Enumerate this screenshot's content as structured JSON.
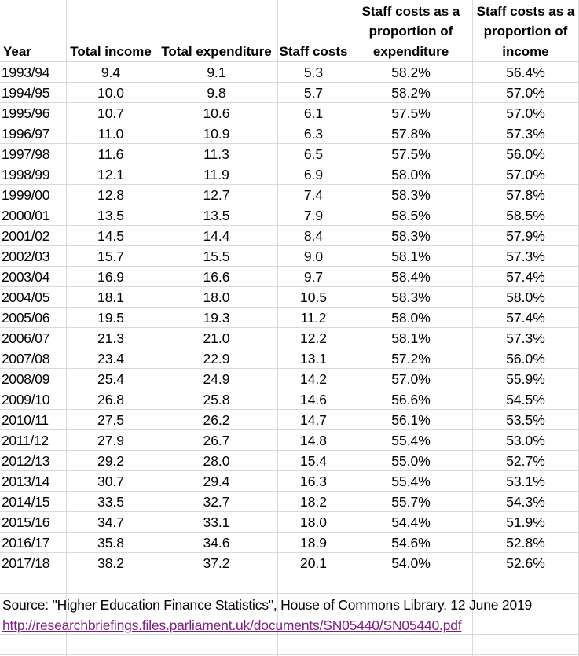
{
  "headers": {
    "year": "Year",
    "total_income": "Total income",
    "total_expenditure": "Total expenditure",
    "staff_costs": "Staff costs",
    "staff_pct_expenditure": "Staff costs as a proportion of expenditure",
    "staff_pct_income": "Staff costs as a proportion of income"
  },
  "rows": [
    [
      "1993/94",
      "9.4",
      "9.1",
      "5.3",
      "58.2%",
      "56.4%"
    ],
    [
      "1994/95",
      "10.0",
      "9.8",
      "5.7",
      "58.2%",
      "57.0%"
    ],
    [
      "1995/96",
      "10.7",
      "10.6",
      "6.1",
      "57.5%",
      "57.0%"
    ],
    [
      "1996/97",
      "11.0",
      "10.9",
      "6.3",
      "57.8%",
      "57.3%"
    ],
    [
      "1997/98",
      "11.6",
      "11.3",
      "6.5",
      "57.5%",
      "56.0%"
    ],
    [
      "1998/99",
      "12.1",
      "11.9",
      "6.9",
      "58.0%",
      "57.0%"
    ],
    [
      "1999/00",
      "12.8",
      "12.7",
      "7.4",
      "58.3%",
      "57.8%"
    ],
    [
      "2000/01",
      "13.5",
      "13.5",
      "7.9",
      "58.5%",
      "58.5%"
    ],
    [
      "2001/02",
      "14.5",
      "14.4",
      "8.4",
      "58.3%",
      "57.9%"
    ],
    [
      "2002/03",
      "15.7",
      "15.5",
      "9.0",
      "58.1%",
      "57.3%"
    ],
    [
      "2003/04",
      "16.9",
      "16.6",
      "9.7",
      "58.4%",
      "57.4%"
    ],
    [
      "2004/05",
      "18.1",
      "18.0",
      "10.5",
      "58.3%",
      "58.0%"
    ],
    [
      "2005/06",
      "19.5",
      "19.3",
      "11.2",
      "58.0%",
      "57.4%"
    ],
    [
      "2006/07",
      "21.3",
      "21.0",
      "12.2",
      "58.1%",
      "57.3%"
    ],
    [
      "2007/08",
      "23.4",
      "22.9",
      "13.1",
      "57.2%",
      "56.0%"
    ],
    [
      "2008/09",
      "25.4",
      "24.9",
      "14.2",
      "57.0%",
      "55.9%"
    ],
    [
      "2009/10",
      "26.8",
      "25.8",
      "14.6",
      "56.6%",
      "54.5%"
    ],
    [
      "2010/11",
      "27.5",
      "26.2",
      "14.7",
      "56.1%",
      "53.5%"
    ],
    [
      "2011/12",
      "27.9",
      "26.7",
      "14.8",
      "55.4%",
      "53.0%"
    ],
    [
      "2012/13",
      "29.2",
      "28.0",
      "15.4",
      "55.0%",
      "52.7%"
    ],
    [
      "2013/14",
      "30.7",
      "29.4",
      "16.3",
      "55.4%",
      "53.1%"
    ],
    [
      "2014/15",
      "33.5",
      "32.7",
      "18.2",
      "55.7%",
      "54.3%"
    ],
    [
      "2015/16",
      "34.7",
      "33.1",
      "18.0",
      "54.4%",
      "51.9%"
    ],
    [
      "2016/17",
      "35.8",
      "34.6",
      "18.9",
      "54.6%",
      "52.8%"
    ],
    [
      "2017/18",
      "38.2",
      "37.2",
      "20.1",
      "54.0%",
      "52.6%"
    ]
  ],
  "source": "Source: \"Higher Education Finance Statistics\", House of Commons Library, 12 June 2019",
  "link": "http://researchbriefings.files.parliament.uk/documents/SN05440/SN05440.pdf",
  "colors": {
    "link": "#7f1f86",
    "gridline": "#d9d9d9"
  }
}
